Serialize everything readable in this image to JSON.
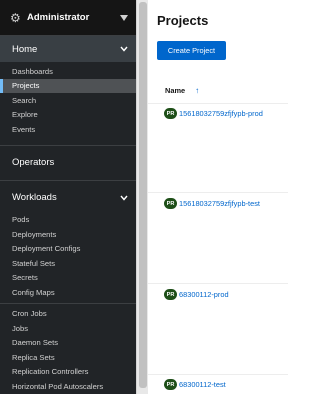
{
  "sidebar": {
    "perspective": "Administrator",
    "home": {
      "label": "Home",
      "items": [
        "Dashboards",
        "Projects",
        "Search",
        "Explore",
        "Events"
      ],
      "active": "Projects"
    },
    "operators": "Operators",
    "workloads": {
      "label": "Workloads",
      "group1": [
        "Pods",
        "Deployments",
        "Deployment Configs",
        "Stateful Sets",
        "Secrets",
        "Config Maps"
      ],
      "group2": [
        "Cron Jobs",
        "Jobs",
        "Daemon Sets",
        "Replica Sets",
        "Replication Controllers",
        "Horizontal Pod Autoscalers"
      ]
    }
  },
  "main": {
    "title": "Projects",
    "create_label": "Create Project",
    "column": "Name",
    "badge": "PR",
    "projects": [
      "15618032759zfjfypb-prod",
      "15618032759zfjfypb-test",
      "68300112-prod",
      "68300112-test"
    ]
  },
  "colors": {
    "sidebar_bg": "#212427",
    "accent": "#0066cc",
    "badge": "#1e4f18",
    "active_border": "#73bcf7"
  }
}
